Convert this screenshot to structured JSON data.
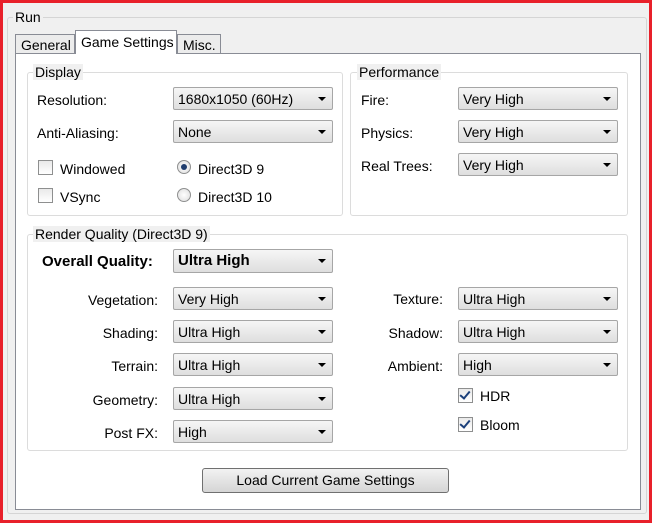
{
  "window": {
    "run_label": "Run",
    "frame_color": "#e8202a"
  },
  "tabs": [
    {
      "label": "General",
      "active": false
    },
    {
      "label": "Game Settings",
      "active": true
    },
    {
      "label": "Misc.",
      "active": false
    }
  ],
  "display": {
    "title": "Display",
    "resolution_label": "Resolution:",
    "resolution_value": "1680x1050 (60Hz)",
    "antialiasing_label": "Anti-Aliasing:",
    "antialiasing_value": "None",
    "windowed_label": "Windowed",
    "windowed_checked": false,
    "vsync_label": "VSync",
    "vsync_checked": false,
    "d3d9_label": "Direct3D 9",
    "d3d9_selected": true,
    "d3d10_label": "Direct3D 10",
    "d3d10_selected": false
  },
  "performance": {
    "title": "Performance",
    "fire_label": "Fire:",
    "fire_value": "Very High",
    "physics_label": "Physics:",
    "physics_value": "Very High",
    "trees_label": "Real Trees:",
    "trees_value": "Very High"
  },
  "render": {
    "title": "Render Quality (Direct3D 9)",
    "overall_label": "Overall Quality:",
    "overall_value": "Ultra High",
    "vegetation_label": "Vegetation:",
    "vegetation_value": "Very High",
    "shading_label": "Shading:",
    "shading_value": "Ultra High",
    "terrain_label": "Terrain:",
    "terrain_value": "Ultra High",
    "geometry_label": "Geometry:",
    "geometry_value": "Ultra High",
    "postfx_label": "Post FX:",
    "postfx_value": "High",
    "texture_label": "Texture:",
    "texture_value": "Ultra High",
    "shadow_label": "Shadow:",
    "shadow_value": "Ultra High",
    "ambient_label": "Ambient:",
    "ambient_value": "High",
    "hdr_label": "HDR",
    "hdr_checked": true,
    "bloom_label": "Bloom",
    "bloom_checked": true
  },
  "actions": {
    "load_label": "Load Current Game Settings"
  }
}
